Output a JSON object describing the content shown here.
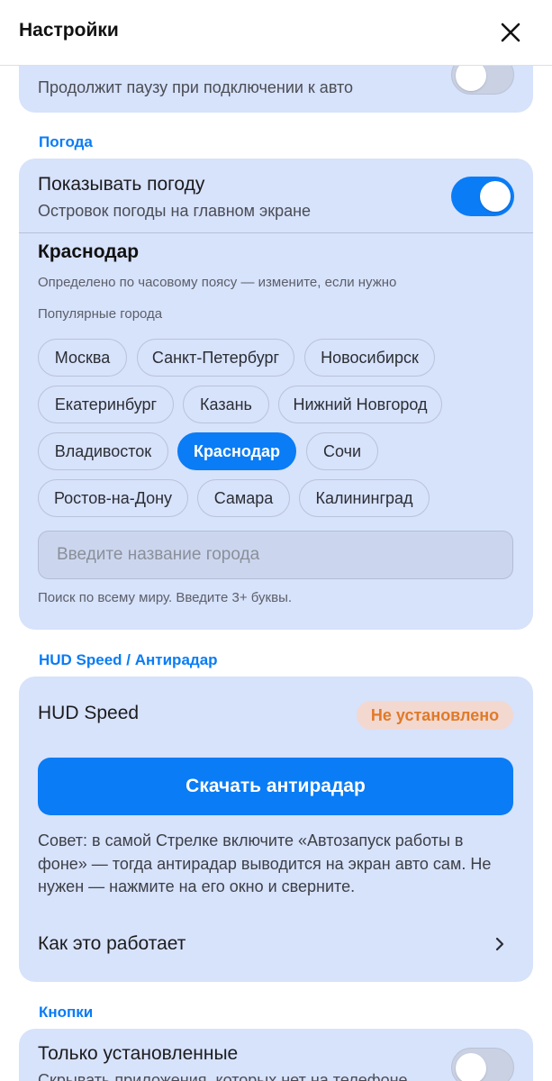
{
  "header": {
    "title": "Настройки"
  },
  "card_top": {
    "subtitle": "Продолжит паузу при подключении к авто",
    "toggle_on": false
  },
  "weather": {
    "section_title": "Погода",
    "show_title": "Показывать погоду",
    "show_subtitle": "Островок погоды на главном экране",
    "toggle_on": true,
    "city_name": "Краснодар",
    "detected_note": "Определено по часовому поясу — измените, если нужно",
    "popular_label": "Популярные города",
    "cities": [
      "Москва",
      "Санкт-Петербург",
      "Новосибирск",
      "Екатеринбург",
      "Казань",
      "Нижний Новгород",
      "Владивосток",
      "Краснодар",
      "Сочи",
      "Ростов-на-Дону",
      "Самара",
      "Калининград"
    ],
    "selected_city": "Краснодар",
    "input_value": "",
    "input_placeholder": "Введите название города",
    "search_hint": "Поиск по всему миру. Введите 3+ буквы."
  },
  "hud": {
    "section_title": "HUD Speed / Антирадар",
    "app_name": "HUD Speed",
    "status_badge": "Не установлено",
    "download_button": "Скачать антирадар",
    "tip": "Совет: в самой Стрелке включите «Автозапуск работы в фоне» — тогда антирадар выводится на экран авто сам. Не нужен — нажмите на его окно и сверните.",
    "how_it_works": "Как это работает"
  },
  "buttons": {
    "section_title": "Кнопки",
    "only_installed_title": "Только установленные",
    "only_installed_subtitle": "Скрывать приложения, которых нет на телефоне",
    "toggle_on": false
  },
  "colors": {
    "accent": "#0a7cf5",
    "card_bg": "#d7e2fb",
    "badge_text": "#e07a28",
    "badge_bg": "#f3d8d0"
  },
  "icons": {
    "close": "close-icon",
    "chevron": "chevron-right-icon"
  }
}
